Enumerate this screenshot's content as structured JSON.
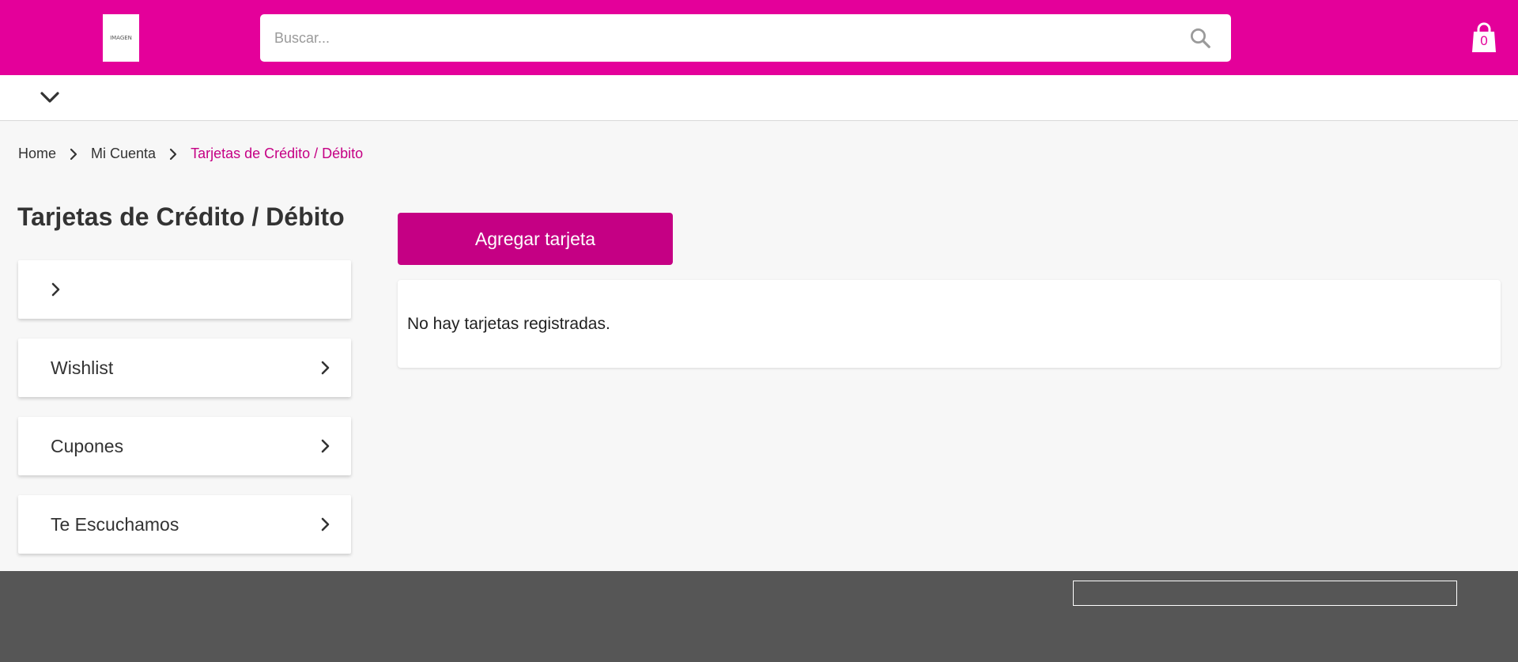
{
  "header": {
    "logo_text": "IMAGEN",
    "search_placeholder": "Buscar...",
    "cart_count": "0",
    "brand_color": "#e4009a"
  },
  "breadcrumb": {
    "home": "Home",
    "account": "Mi Cuenta",
    "current": "Tarjetas de Crédito / Débito"
  },
  "page": {
    "title": "Tarjetas de Crédito / Débito"
  },
  "sidebar": {
    "items": [
      {
        "label": ""
      },
      {
        "label": "Wishlist"
      },
      {
        "label": "Cupones"
      },
      {
        "label": "Te Escuchamos"
      }
    ]
  },
  "main": {
    "add_card_label": "Agregar tarjeta",
    "empty_message": "No hay tarjetas registradas.",
    "accent_color": "#c50084"
  },
  "footer": {
    "input_value": ""
  }
}
